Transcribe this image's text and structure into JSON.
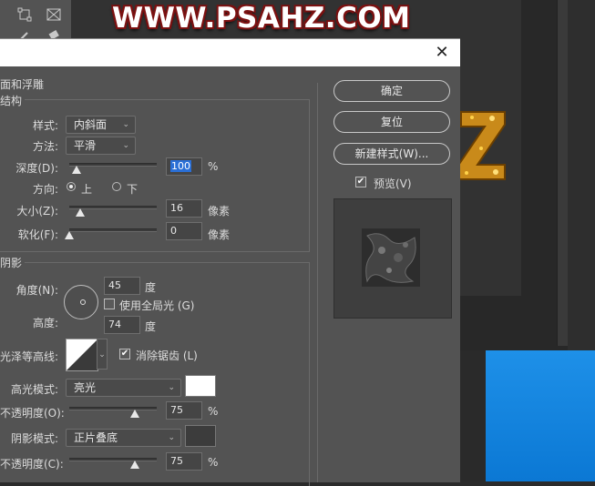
{
  "background": {
    "watermark": "WWW.PSAHZ.COM",
    "tools": [
      "transform-icon",
      "crop-frame-icon",
      "eyedropper-icon",
      "eraser-icon"
    ]
  },
  "dialog": {
    "section_title": "面和浮雕",
    "structure": {
      "title": "结构",
      "style_label": "样式:",
      "style_value": "内斜面",
      "method_label": "方法:",
      "method_value": "平滑",
      "depth_label": "深度(D):",
      "depth_value": "100",
      "depth_unit": "%",
      "direction_label": "方向:",
      "direction_up": "上",
      "direction_down": "下",
      "size_label": "大小(Z):",
      "size_value": "16",
      "size_unit": "像素",
      "soften_label": "软化(F):",
      "soften_value": "0",
      "soften_unit": "像素",
      "depth_level": 0.08,
      "size_level": 0.12,
      "soften_level": 0.0
    },
    "shading": {
      "title": "阴影",
      "angle_label": "角度(N):",
      "angle_value": "45",
      "angle_unit": "度",
      "global_light_label": "使用全局光 (G)",
      "global_light_checked": false,
      "altitude_label": "高度:",
      "altitude_value": "74",
      "altitude_unit": "度",
      "gloss_contour_label": "光泽等高线:",
      "anti_alias_label": "消除锯齿 (L)",
      "anti_alias_checked": true,
      "highlight_mode_label": "高光模式:",
      "highlight_mode_value": "亮光",
      "highlight_color": "#ffffff",
      "highlight_opacity_label": "不透明度(O):",
      "highlight_opacity_value": "75",
      "highlight_opacity_unit": "%",
      "shadow_mode_label": "阴影模式:",
      "shadow_mode_value": "正片叠底",
      "shadow_color": "#3c3c3c",
      "shadow_opacity_label": "不透明度(C):",
      "shadow_opacity_value": "75",
      "shadow_opacity_unit": "%",
      "highlight_opacity_level": 0.75,
      "shadow_opacity_level": 0.75
    },
    "buttons": {
      "ok": "确定",
      "reset": "复位",
      "new_style": "新建样式(W)..."
    },
    "preview_label": "预览(V)",
    "preview_checked": true
  }
}
